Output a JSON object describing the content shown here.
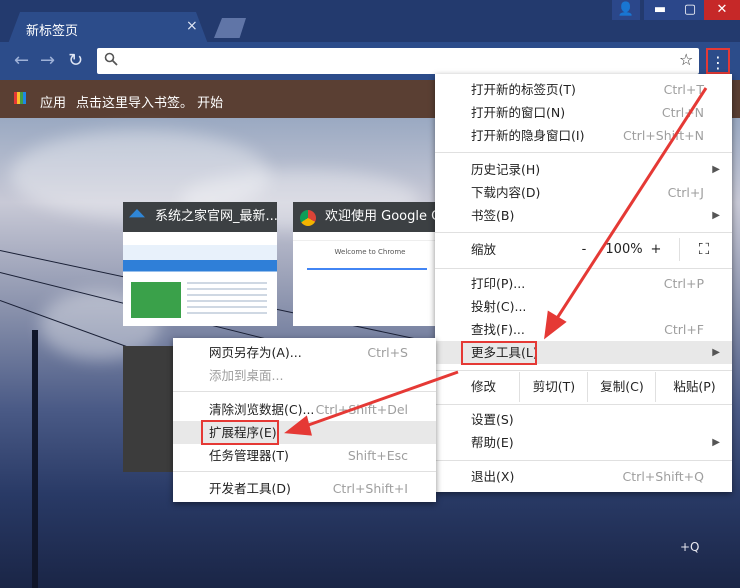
{
  "tab": {
    "title": "新标签页",
    "close": "×"
  },
  "window": {
    "user": "👤",
    "min": "▬",
    "max": "▢",
    "close": "✕"
  },
  "toolbar": {
    "back": "←",
    "forward": "→",
    "reload": "↻",
    "search_icon": "search-icon",
    "star": "☆",
    "menu": "⋮",
    "omnibox_value": ""
  },
  "bookmarks": {
    "apps_label": "应用",
    "import_text": "点击这里导入书签。 开始"
  },
  "thumbnails": [
    {
      "title": "系统之家官网_最新..."
    },
    {
      "title": "欢迎使用 Google C..."
    }
  ],
  "thumb_content": {
    "welcome": "Welcome to Chrome"
  },
  "main_menu": {
    "items": [
      {
        "label": "打开新的标签页(T)",
        "shortcut": "Ctrl+T"
      },
      {
        "label": "打开新的窗口(N)",
        "shortcut": "Ctrl+N"
      },
      {
        "label": "打开新的隐身窗口(I)",
        "shortcut": "Ctrl+Shift+N"
      },
      {
        "label": "历史记录(H)",
        "shortcut": ""
      },
      {
        "label": "下载内容(D)",
        "shortcut": "Ctrl+J"
      },
      {
        "label": "书签(B)",
        "shortcut": ""
      },
      {
        "label": "打印(P)...",
        "shortcut": "Ctrl+P"
      },
      {
        "label": "投射(C)...",
        "shortcut": ""
      },
      {
        "label": "查找(F)...",
        "shortcut": "Ctrl+F"
      },
      {
        "label": "更多工具(L)",
        "shortcut": ""
      },
      {
        "label": "设置(S)",
        "shortcut": ""
      },
      {
        "label": "帮助(E)",
        "shortcut": ""
      },
      {
        "label": "退出(X)",
        "shortcut": "Ctrl+Shift+Q"
      }
    ],
    "zoom": {
      "label": "缩放",
      "minus": "-",
      "value": "100%",
      "plus": "+",
      "fullscreen": "⛶"
    },
    "edit": {
      "label": "修改",
      "cut": "剪切(T)",
      "copy": "复制(C)",
      "paste": "粘贴(P)"
    }
  },
  "submenu": {
    "items": [
      {
        "label": "网页另存为(A)...",
        "shortcut": "Ctrl+S"
      },
      {
        "label": "添加到桌面...",
        "shortcut": ""
      },
      {
        "label": "清除浏览数据(C)...",
        "shortcut": "Ctrl+Shift+Del"
      },
      {
        "label": "扩展程序(E)",
        "shortcut": ""
      },
      {
        "label": "任务管理器(T)",
        "shortcut": "Shift+Esc"
      },
      {
        "label": "开发者工具(D)",
        "shortcut": "Ctrl+Shift+I"
      }
    ]
  },
  "overlay_text": "+Q",
  "colors": {
    "accent_red": "#e53935",
    "toolbar_blue": "#2c4c8a",
    "bookbar_brown": "#5a3f33"
  }
}
